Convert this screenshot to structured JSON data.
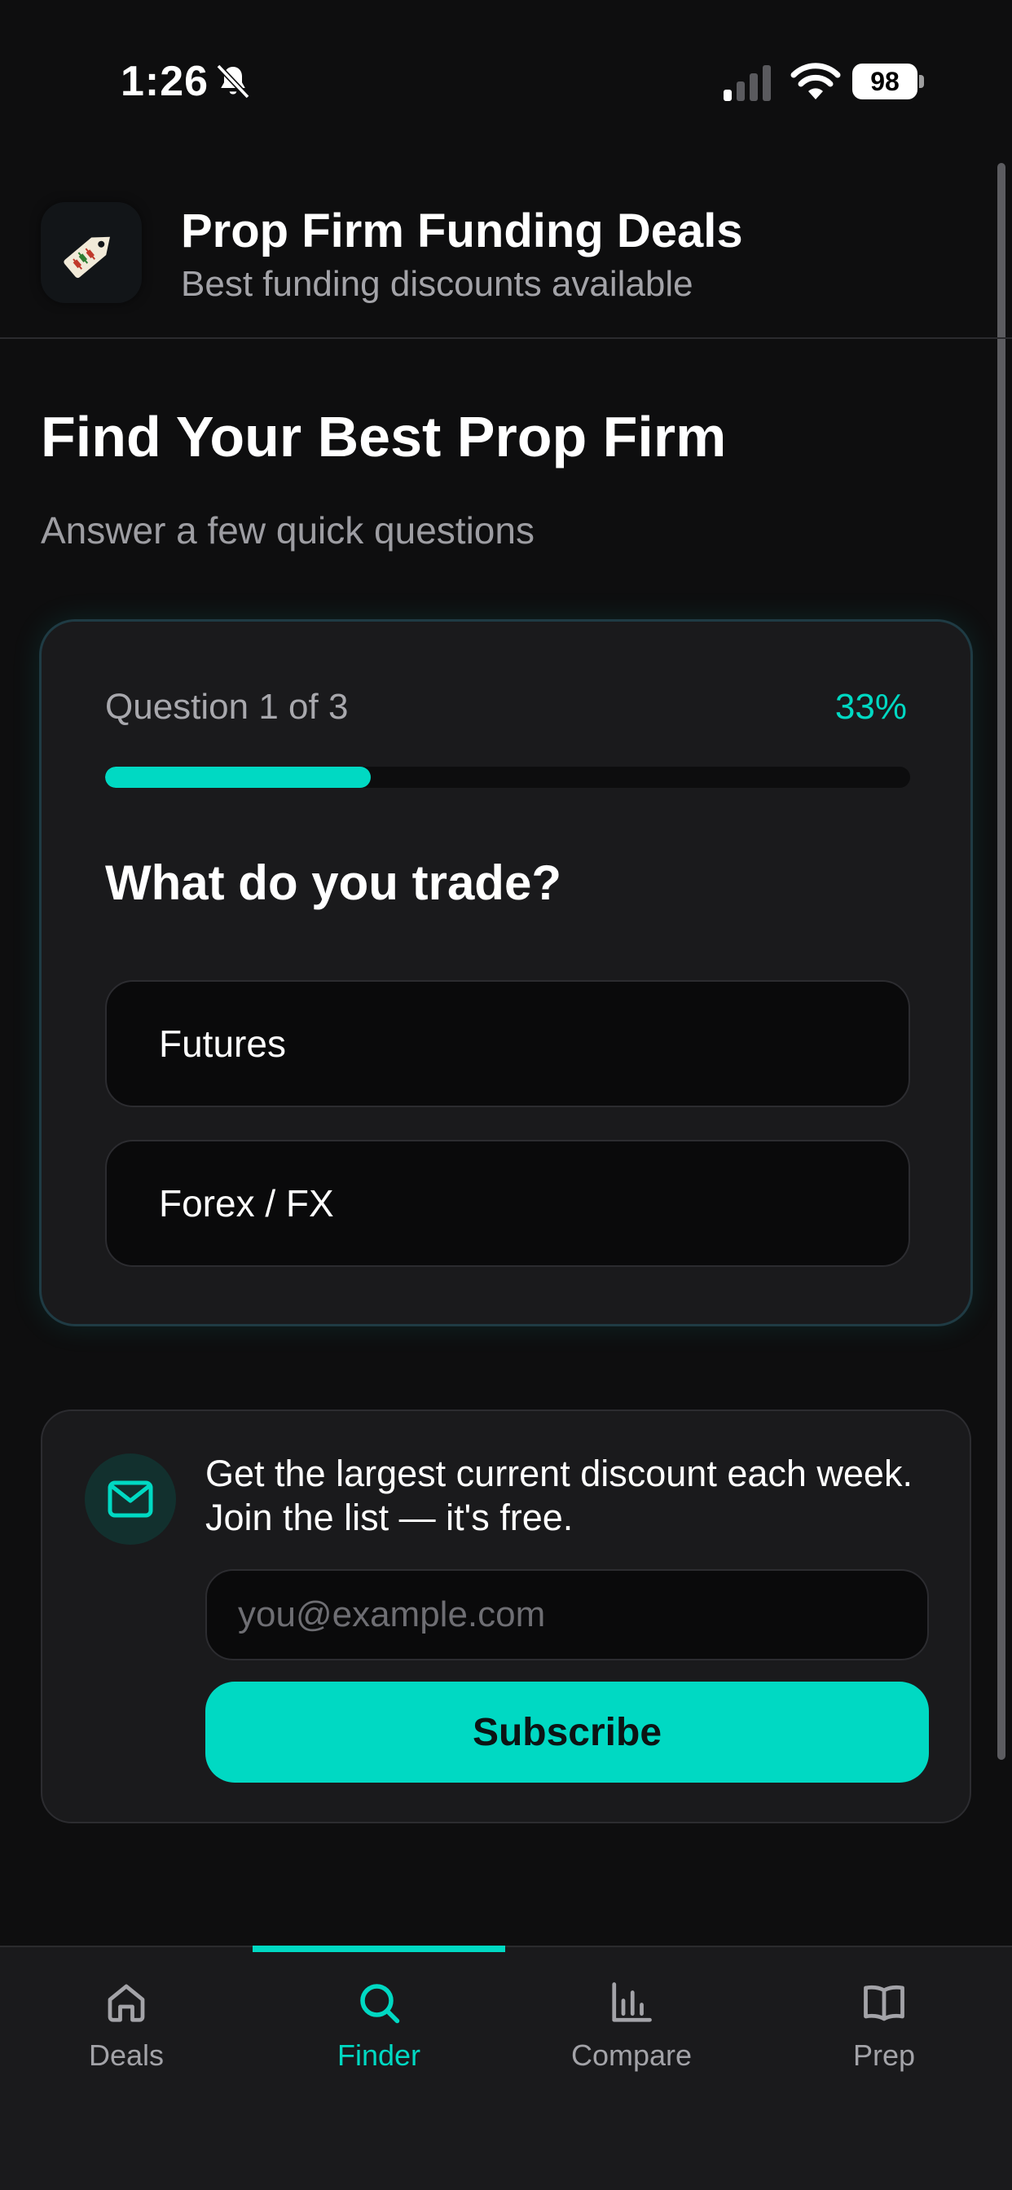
{
  "status_bar": {
    "time": "1:26",
    "battery": "98"
  },
  "header": {
    "title": "Prop Firm Funding Deals",
    "subtitle": "Best funding discounts available"
  },
  "page": {
    "title": "Find Your Best Prop Firm",
    "subtitle": "Answer a few quick questions"
  },
  "quiz": {
    "counter": "Question 1 of 3",
    "percent_label": "33%",
    "progress_fraction": 0.33,
    "question": "What do you trade?",
    "options": [
      "Futures",
      "Forex / FX"
    ]
  },
  "newsletter": {
    "text": "Get the largest current discount each week. Join the list — it's free.",
    "email_placeholder": "you@example.com",
    "subscribe_label": "Subscribe"
  },
  "nav": {
    "active": "Finder",
    "items": [
      {
        "label": "Deals",
        "icon": "home-icon"
      },
      {
        "label": "Finder",
        "icon": "search-icon"
      },
      {
        "label": "Compare",
        "icon": "bar-chart-icon"
      },
      {
        "label": "Prep",
        "icon": "book-icon"
      }
    ]
  },
  "colors": {
    "accent": "#00d9c3",
    "background": "#0e0e0f",
    "card": "#1a1a1c"
  }
}
